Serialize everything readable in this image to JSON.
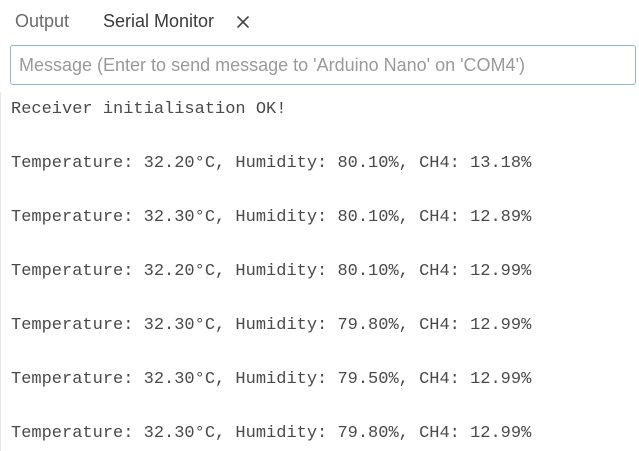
{
  "tabs": [
    {
      "label": "Output",
      "active": false
    },
    {
      "label": "Serial Monitor",
      "active": true
    }
  ],
  "message_input": {
    "value": "",
    "placeholder": "Message (Enter to send message to 'Arduino Nano' on 'COM4')"
  },
  "serial_output": [
    "Receiver initialisation OK!",
    "Temperature: 32.20°C, Humidity: 80.10%, CH4: 13.18%",
    "Temperature: 32.30°C, Humidity: 80.10%, CH4: 12.89%",
    "Temperature: 32.20°C, Humidity: 80.10%, CH4: 12.99%",
    "Temperature: 32.30°C, Humidity: 79.80%, CH4: 12.99%",
    "Temperature: 32.30°C, Humidity: 79.50%, CH4: 12.99%",
    "Temperature: 32.30°C, Humidity: 79.80%, CH4: 12.99%"
  ],
  "colors": {
    "input_border": "#8fb8c4",
    "tab_text": "#6b6b6b",
    "active_tab_text": "#3b3b3b",
    "output_text": "#4a4a4a"
  },
  "icons": {
    "close": "close-icon"
  }
}
